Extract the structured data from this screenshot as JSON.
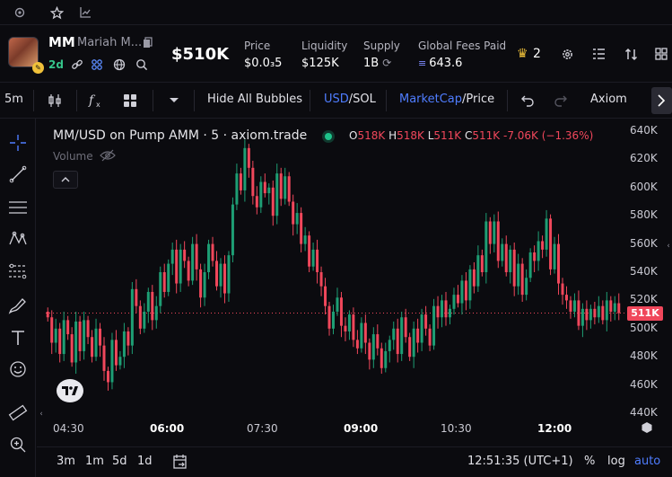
{
  "top_strip": {
    "icons": [
      "gear-icon",
      "star-icon",
      "chart-icon"
    ]
  },
  "token": {
    "symbol": "MM",
    "name": "Mariah M...",
    "age": "2d",
    "market_cap": "$510K",
    "stats": [
      {
        "label": "Price",
        "value": "$0.0₃5"
      },
      {
        "label": "Liquidity",
        "value": "$125K"
      },
      {
        "label": "Supply",
        "value": "1B"
      },
      {
        "label": "Global Fees Paid",
        "value": "643.6"
      }
    ],
    "crown_count": "2"
  },
  "toolbar": {
    "interval": "5m",
    "hide_bubbles": "Hide All Bubbles",
    "currency_a": "USD",
    "currency_b": "SOL",
    "metric_a": "MarketCap",
    "metric_b": "Price",
    "source": "Axiom",
    "slash": "/"
  },
  "chart": {
    "legend_title": "MM/USD on Pump AMM · 5 · axiom.trade",
    "ohlc": {
      "o_label": "O",
      "o": "518K",
      "h_label": "H",
      "h": "518K",
      "l_label": "L",
      "l": "511K",
      "c_label": "C",
      "c": "511K",
      "change": "-7.06K (−1.36%)"
    },
    "volume_label": "Volume",
    "last_price_label": "511K",
    "colors": {
      "up": "#1e9e74",
      "down": "#f0475b",
      "accent": "#4f7dff",
      "background": "#0b0b0f"
    }
  },
  "bottom_bar": {
    "ranges": [
      "3m",
      "1m",
      "5d",
      "1d"
    ],
    "clock": "12:51:35 (UTC+1)",
    "percent": "%",
    "log": "log",
    "auto": "auto"
  },
  "chart_data": {
    "type": "candlestick",
    "title": "MM/USD on Pump AMM · 5 · axiom.trade",
    "xlabel": "",
    "ylabel": "",
    "ylim": [
      440,
      640
    ],
    "y_ticks": [
      "640K",
      "620K",
      "600K",
      "580K",
      "560K",
      "540K",
      "520K",
      "500K",
      "480K",
      "460K",
      "440K"
    ],
    "x_ticks": [
      "04:30",
      "06:00",
      "07:30",
      "09:00",
      "10:30",
      "12:00"
    ],
    "x_ticks_bold": [
      false,
      true,
      false,
      true,
      false,
      true
    ],
    "series": [
      {
        "name": "MM/USD",
        "close": [
          508,
          490,
          500,
          482,
          506,
          496,
          476,
          505,
          484,
          506,
          494,
          480,
          500,
          488,
          470,
          462,
          492,
          474,
          480,
          498,
          488,
          528,
          516,
          500,
          512,
          526,
          506,
          516,
          540,
          526,
          546,
          556,
          532,
          556,
          548,
          534,
          560,
          542,
          522,
          540,
          560,
          548,
          530,
          546,
          525,
          552,
          588,
          610,
          598,
          628,
          614,
          594,
          586,
          604,
          596,
          600,
          580,
          610,
          592,
          608,
          590,
          574,
          582,
          560,
          566,
          544,
          556,
          540,
          530,
          516,
          500,
          512,
          522,
          502,
          498,
          510,
          492,
          486,
          504,
          490,
          478,
          496,
          486,
          472,
          484,
          492,
          500,
          482,
          508,
          494,
          480,
          500,
          490,
          510,
          500,
          488,
          516,
          508,
          520,
          508,
          514,
          524,
          518,
          534,
          520,
          542,
          530,
          552,
          540,
          576,
          560,
          576,
          548,
          560,
          540,
          556,
          530,
          546,
          524,
          536,
          554,
          548,
          562,
          556,
          578,
          542,
          560,
          532,
          524,
          520,
          512,
          520,
          502,
          514,
          506,
          514,
          508,
          516,
          506,
          520,
          512,
          518,
          511
        ]
      }
    ]
  }
}
